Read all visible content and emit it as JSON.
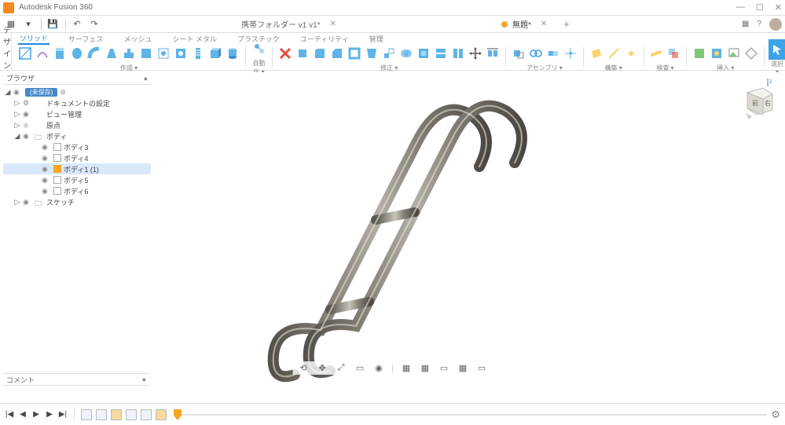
{
  "titlebar": {
    "app_name": "Autodesk Fusion 360",
    "minimize": "—",
    "maximize": "☐",
    "close": "✕"
  },
  "qat": {
    "grid": "▦",
    "new": "▾",
    "save": "💾",
    "undo": "↶",
    "redo": "↷"
  },
  "tabs": [
    {
      "label": "携帯フォルダー v1 v1*",
      "has_dot": false,
      "active": false
    },
    {
      "label": "無題*",
      "has_dot": true,
      "active": true
    }
  ],
  "tab_add": "+",
  "header_right": {
    "ext": "▦",
    "help": "?",
    "avatar": "●"
  },
  "design_button": "デザイン ▾",
  "ribbon_tabs": [
    {
      "label": "ソリッド",
      "active": true
    },
    {
      "label": "サーフェス",
      "active": false
    },
    {
      "label": "メッシュ",
      "active": false
    },
    {
      "label": "シート メタル",
      "active": false
    },
    {
      "label": "プラスチック",
      "active": false
    },
    {
      "label": "ユーティリティ",
      "active": false
    },
    {
      "label": "管理",
      "active": false
    }
  ],
  "ribbon_groups": {
    "create": "作成 ▾",
    "auto": "自動化 ▾",
    "modify": "修正 ▾",
    "assemble": "アセンブリ ▾",
    "construct": "構築 ▾",
    "inspect": "検査 ▾",
    "insert": "挿入 ▾",
    "select": "選択 ▾"
  },
  "browser": {
    "title": "ブラウザ",
    "pin": "●",
    "root": "(未保存)",
    "nodes": [
      {
        "label": "ドキュメントの設定",
        "type": "settings",
        "indent": 1,
        "caret": "▷",
        "eye": false
      },
      {
        "label": "ビュー管理",
        "type": "views",
        "indent": 1,
        "caret": "▷",
        "eye": true
      },
      {
        "label": "原点",
        "type": "origin",
        "indent": 1,
        "caret": "▷",
        "eye": "dim"
      },
      {
        "label": "ボディ",
        "type": "folder",
        "indent": 1,
        "caret": "◢",
        "eye": true
      },
      {
        "label": "ボディ3",
        "type": "body",
        "indent": 2,
        "caret": "",
        "eye": true
      },
      {
        "label": "ボディ4",
        "type": "body",
        "indent": 2,
        "caret": "",
        "eye": true
      },
      {
        "label": "ボディ1 (1)",
        "type": "component",
        "indent": 2,
        "caret": "",
        "eye": true,
        "selected": true
      },
      {
        "label": "ボディ5",
        "type": "body",
        "indent": 2,
        "caret": "",
        "eye": true
      },
      {
        "label": "ボディ6",
        "type": "body",
        "indent": 2,
        "caret": "",
        "eye": true
      },
      {
        "label": "スケッチ",
        "type": "folder",
        "indent": 1,
        "caret": "▷",
        "eye": true
      }
    ]
  },
  "viewcube": {
    "front": "前",
    "right": "右"
  },
  "comment": {
    "label": "コメント",
    "pin": "●"
  },
  "nav": {
    "orbit": "⟲",
    "pan": "✥",
    "zoom": "⤢",
    "fit": "▭",
    "look": "◉",
    "grid1": "▦",
    "grid2": "▦",
    "display": "▭",
    "render": "▦",
    "perf": "▭"
  },
  "timeline": {
    "first": "|◀",
    "prev": "◀",
    "play": "▶",
    "next": "▶",
    "last": "▶|",
    "gear": "⚙"
  }
}
